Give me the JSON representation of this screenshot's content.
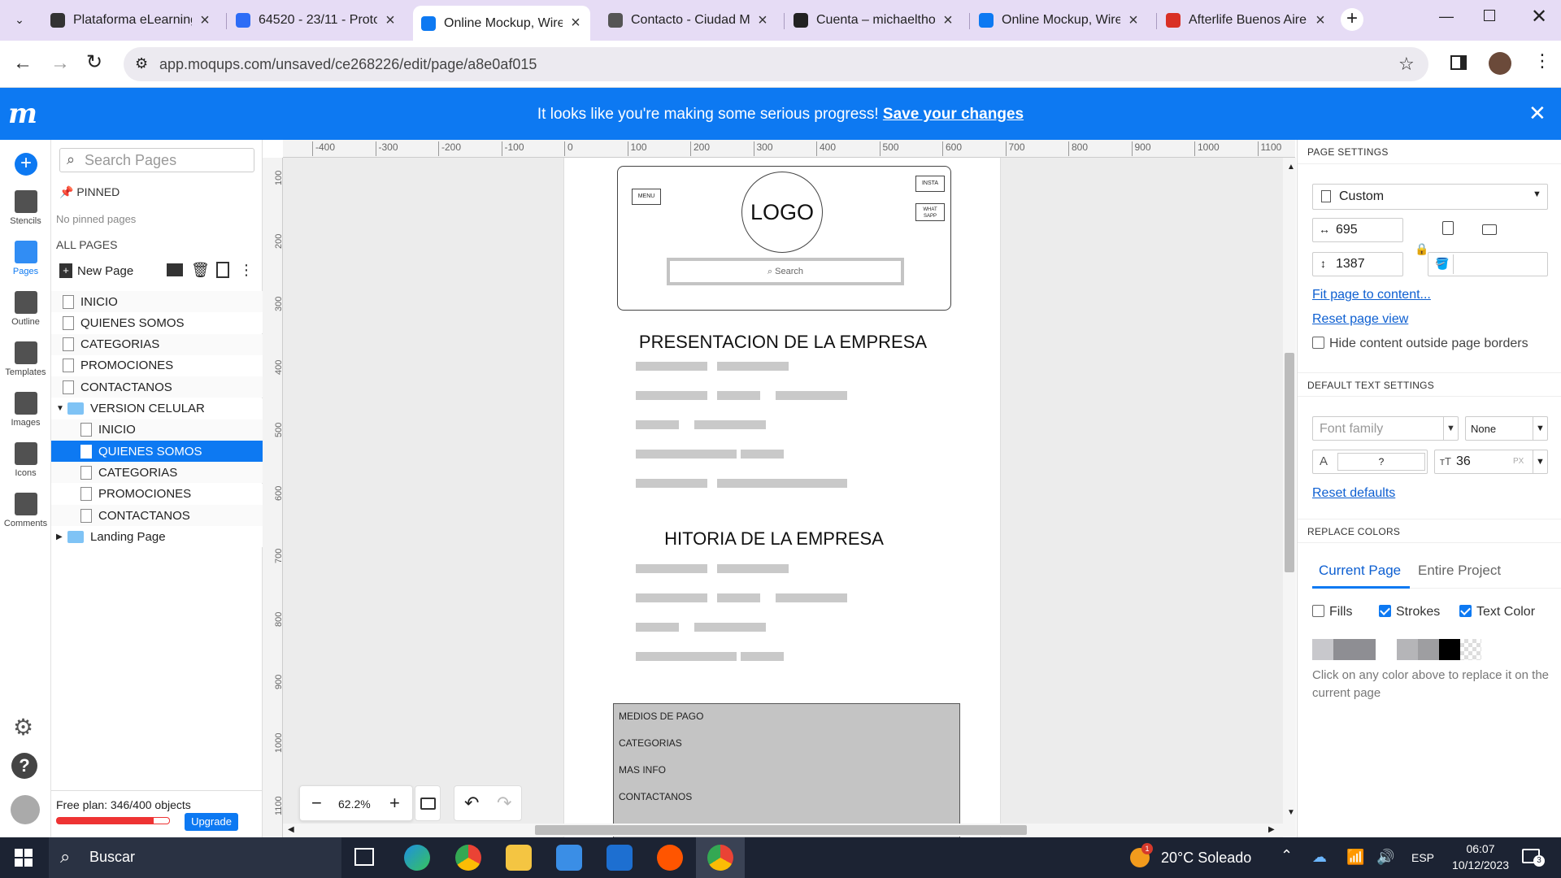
{
  "browser": {
    "tabs": [
      {
        "title": "Plataforma eLearning",
        "icon": "elearning-icon",
        "color": "#333"
      },
      {
        "title": "64520 - 23/11 - Proto",
        "icon": "zoom-icon",
        "color": "#2d6cf6"
      },
      {
        "title": "Online Mockup, Wire",
        "icon": "moqups-icon",
        "color": "#0d79f2",
        "active": true
      },
      {
        "title": "Contacto - Ciudad M",
        "icon": "site-icon",
        "color": "#555"
      },
      {
        "title": "Cuenta – michaeltho",
        "icon": "h-icon",
        "color": "#222"
      },
      {
        "title": "Online Mockup, Wire",
        "icon": "moqups-icon",
        "color": "#0d79f2"
      },
      {
        "title": "Afterlife Buenos Aire",
        "icon": "gmail-icon",
        "color": "#d93025"
      }
    ],
    "url": "app.moqups.com/unsaved/ce268226/edit/page/a8e0af015"
  },
  "banner": {
    "message": "It looks like you're making some serious progress!",
    "link": "Save your changes"
  },
  "rail": {
    "items": [
      {
        "label": "Stencils",
        "icon": "stencils-icon"
      },
      {
        "label": "Pages",
        "icon": "pages-icon"
      },
      {
        "label": "Outline",
        "icon": "outline-icon"
      },
      {
        "label": "Templates",
        "icon": "templates-icon"
      },
      {
        "label": "Images",
        "icon": "images-icon"
      },
      {
        "label": "Icons",
        "icon": "icons-icon"
      },
      {
        "label": "Comments",
        "icon": "comments-icon"
      }
    ]
  },
  "pages_panel": {
    "search_placeholder": "Search Pages",
    "pinned_label": "PINNED",
    "no_pinned": "No pinned pages",
    "all_pages_label": "ALL PAGES",
    "new_page_label": "New Page",
    "pages": [
      {
        "label": "INICIO",
        "level": 0,
        "type": "page"
      },
      {
        "label": "QUIENES SOMOS",
        "level": 0,
        "type": "page"
      },
      {
        "label": "CATEGORIAS",
        "level": 0,
        "type": "page"
      },
      {
        "label": "PROMOCIONES",
        "level": 0,
        "type": "page"
      },
      {
        "label": "CONTACTANOS",
        "level": 0,
        "type": "page"
      },
      {
        "label": "VERSION CELULAR",
        "level": 0,
        "type": "folder",
        "expanded": true
      },
      {
        "label": "INICIO",
        "level": 1,
        "type": "page"
      },
      {
        "label": "QUIENES SOMOS",
        "level": 1,
        "type": "page",
        "selected": true
      },
      {
        "label": "CATEGORIAS",
        "level": 1,
        "type": "page"
      },
      {
        "label": "PROMOCIONES",
        "level": 1,
        "type": "page"
      },
      {
        "label": "CONTACTANOS",
        "level": 1,
        "type": "page"
      },
      {
        "label": "Landing Page",
        "level": 0,
        "type": "folder",
        "expanded": false
      }
    ],
    "plan_text": "Free plan: 346/400 objects",
    "plan_usage": 0.865,
    "upgrade_label": "Upgrade"
  },
  "ruler": {
    "h_ticks": [
      "-400",
      "-300",
      "-200",
      "-100",
      "0",
      "100",
      "200",
      "300",
      "400",
      "500",
      "600",
      "700",
      "800",
      "900",
      "1000",
      "1100"
    ],
    "v_ticks": [
      "100",
      "200",
      "300",
      "400",
      "500",
      "600",
      "700",
      "800",
      "900",
      "1000",
      "1100"
    ]
  },
  "mockup": {
    "menu_label": "MENU",
    "logo_label": "LOGO",
    "insta_label": "INSTA",
    "whatsapp_label": "WHAT SAPP",
    "search_label": "Search",
    "heading1": "PRESENTACION DE LA EMPRESA",
    "heading2": "HITORIA DE LA EMPRESA",
    "footer_items": [
      "MEDIOS DE PAGO",
      "CATEGORIAS",
      "MAS INFO",
      "CONTACTANOS"
    ]
  },
  "zoom": {
    "value": "62.2%"
  },
  "page_settings": {
    "header": "PAGE SETTINGS",
    "preset": "Custom",
    "width": "695",
    "height": "1387",
    "fit_link": "Fit page to content...",
    "reset_link": "Reset page view",
    "hide_label": "Hide content outside page borders",
    "hide_checked": false
  },
  "text_settings": {
    "header": "DEFAULT TEXT SETTINGS",
    "font_family_placeholder": "Font family",
    "style": "None",
    "color_value": "?",
    "size": "36",
    "size_unit": "PX",
    "reset_link": "Reset defaults"
  },
  "replace_colors": {
    "header": "REPLACE COLORS",
    "tabs": [
      "Current Page",
      "Entire Project"
    ],
    "active_tab": "Current Page",
    "options": [
      {
        "label": "Fills",
        "checked": false
      },
      {
        "label": "Strokes",
        "checked": true
      },
      {
        "label": "Text Color",
        "checked": true
      }
    ],
    "swatches": [
      "#c8c8cc",
      "#8e8e93",
      "#ffffff",
      "#b5b5b8",
      "#9e9ea1",
      "#000000",
      "transparent"
    ],
    "hint": "Click on any color above to replace it on the current page"
  },
  "taskbar": {
    "search_placeholder": "Buscar",
    "weather": "20°C Soleado",
    "weather_badge": "1",
    "language": "ESP",
    "time": "06:07",
    "date": "10/12/2023",
    "notifications": "3"
  }
}
